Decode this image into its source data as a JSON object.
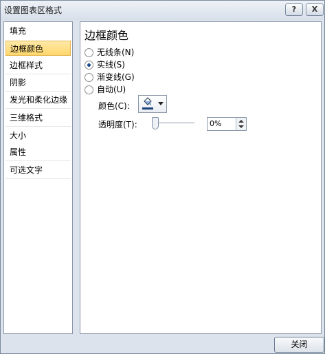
{
  "window": {
    "title": "设置图表区格式",
    "help_label": "?",
    "close_label": "X"
  },
  "nav": {
    "items": [
      {
        "label": "填充"
      },
      {
        "label": "边框颜色"
      },
      {
        "label": "边框样式"
      },
      {
        "label": "阴影"
      },
      {
        "label": "发光和柔化边缘"
      },
      {
        "label": "三维格式"
      },
      {
        "label": "大小"
      },
      {
        "label": "属性"
      },
      {
        "label": "可选文字"
      }
    ],
    "selected": "边框颜色"
  },
  "panel": {
    "title": "边框颜色",
    "options": [
      {
        "label": "无线条(N)",
        "checked": false
      },
      {
        "label": "实线(S)",
        "checked": true
      },
      {
        "label": "渐变线(G)",
        "checked": false
      },
      {
        "label": "自动(U)",
        "checked": false
      }
    ],
    "color_label": "颜色(C):",
    "color_value": "#1a3f7a",
    "transparency_label": "透明度(T):",
    "transparency_value": "0%",
    "transparency_percent": 0
  },
  "footer": {
    "close_label": "关闭"
  },
  "icons": {
    "paint_bucket": "paint-bucket-icon",
    "dropdown": "chevron-down-icon"
  }
}
